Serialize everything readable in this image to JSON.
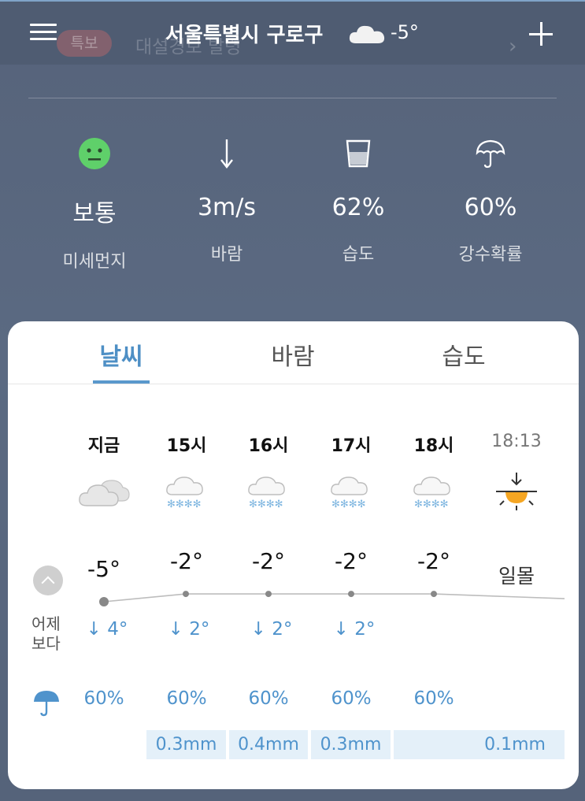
{
  "header": {
    "location": "서울특별시 구로구",
    "current_temp": "-5°",
    "weather_icon": "cloud-icon",
    "alert_badge": "특보",
    "alert_text": "대설경보 발령"
  },
  "stats": [
    {
      "icon": "neutral-face-icon",
      "value": "보통",
      "label": "미세먼지"
    },
    {
      "icon": "wind-arrow-icon",
      "value": "3m/s",
      "label": "바람"
    },
    {
      "icon": "water-glass-icon",
      "value": "62%",
      "label": "습도"
    },
    {
      "icon": "umbrella-icon",
      "value": "60%",
      "label": "강수확률"
    }
  ],
  "tabs": [
    {
      "label": "날씨",
      "active": true
    },
    {
      "label": "바람",
      "active": false
    },
    {
      "label": "습도",
      "active": false
    }
  ],
  "forecast": {
    "yesterday_label_1": "어제",
    "yesterday_label_2": "보다",
    "columns": [
      {
        "time": "지금",
        "icon": "cloud-icon",
        "temp": "-5°",
        "temp_value": -5,
        "diff": "↓ 4°",
        "precip_prob": "60%"
      },
      {
        "time": "15시",
        "icon": "snow-icon",
        "temp": "-2°",
        "temp_value": -2,
        "diff": "↓ 2°",
        "precip_prob": "60%"
      },
      {
        "time": "16시",
        "icon": "snow-icon",
        "temp": "-2°",
        "temp_value": -2,
        "diff": "↓ 2°",
        "precip_prob": "60%"
      },
      {
        "time": "17시",
        "icon": "snow-icon",
        "temp": "-2°",
        "temp_value": -2,
        "diff": "↓ 2°",
        "precip_prob": "60%"
      },
      {
        "time": "18시",
        "icon": "snow-icon",
        "temp": "-2°",
        "temp_value": -2,
        "diff": "",
        "precip_prob": "60%"
      },
      {
        "time": "18:13",
        "icon": "sunset-icon",
        "temp": "일몰",
        "diff": "",
        "precip_prob": ""
      }
    ],
    "rain_amounts": [
      "0.3mm",
      "0.4mm",
      "0.3mm",
      "0.1mm"
    ]
  },
  "colors": {
    "accent": "#4e8fc5",
    "dust_good": "#5fd06a",
    "sun": "#f5a623"
  }
}
